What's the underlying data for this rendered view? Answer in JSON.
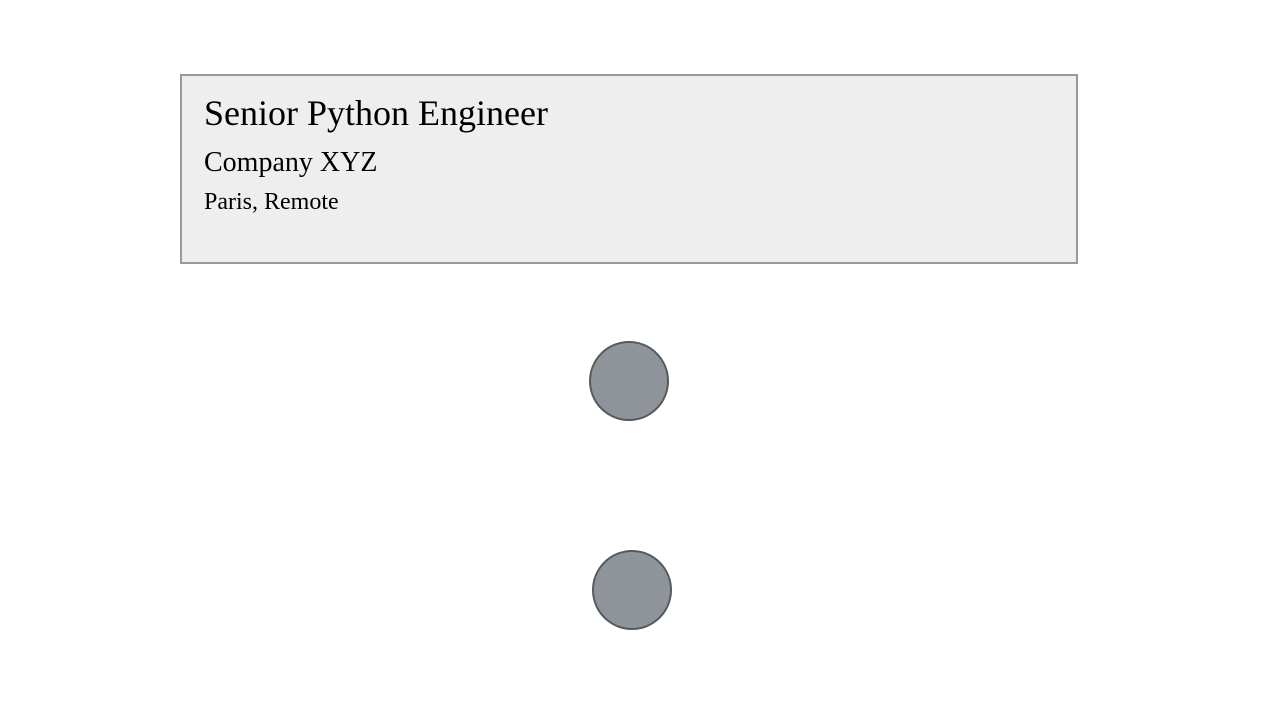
{
  "job_card": {
    "title": "Senior Python Engineer",
    "company": "Company XYZ",
    "location": "Paris, Remote"
  }
}
